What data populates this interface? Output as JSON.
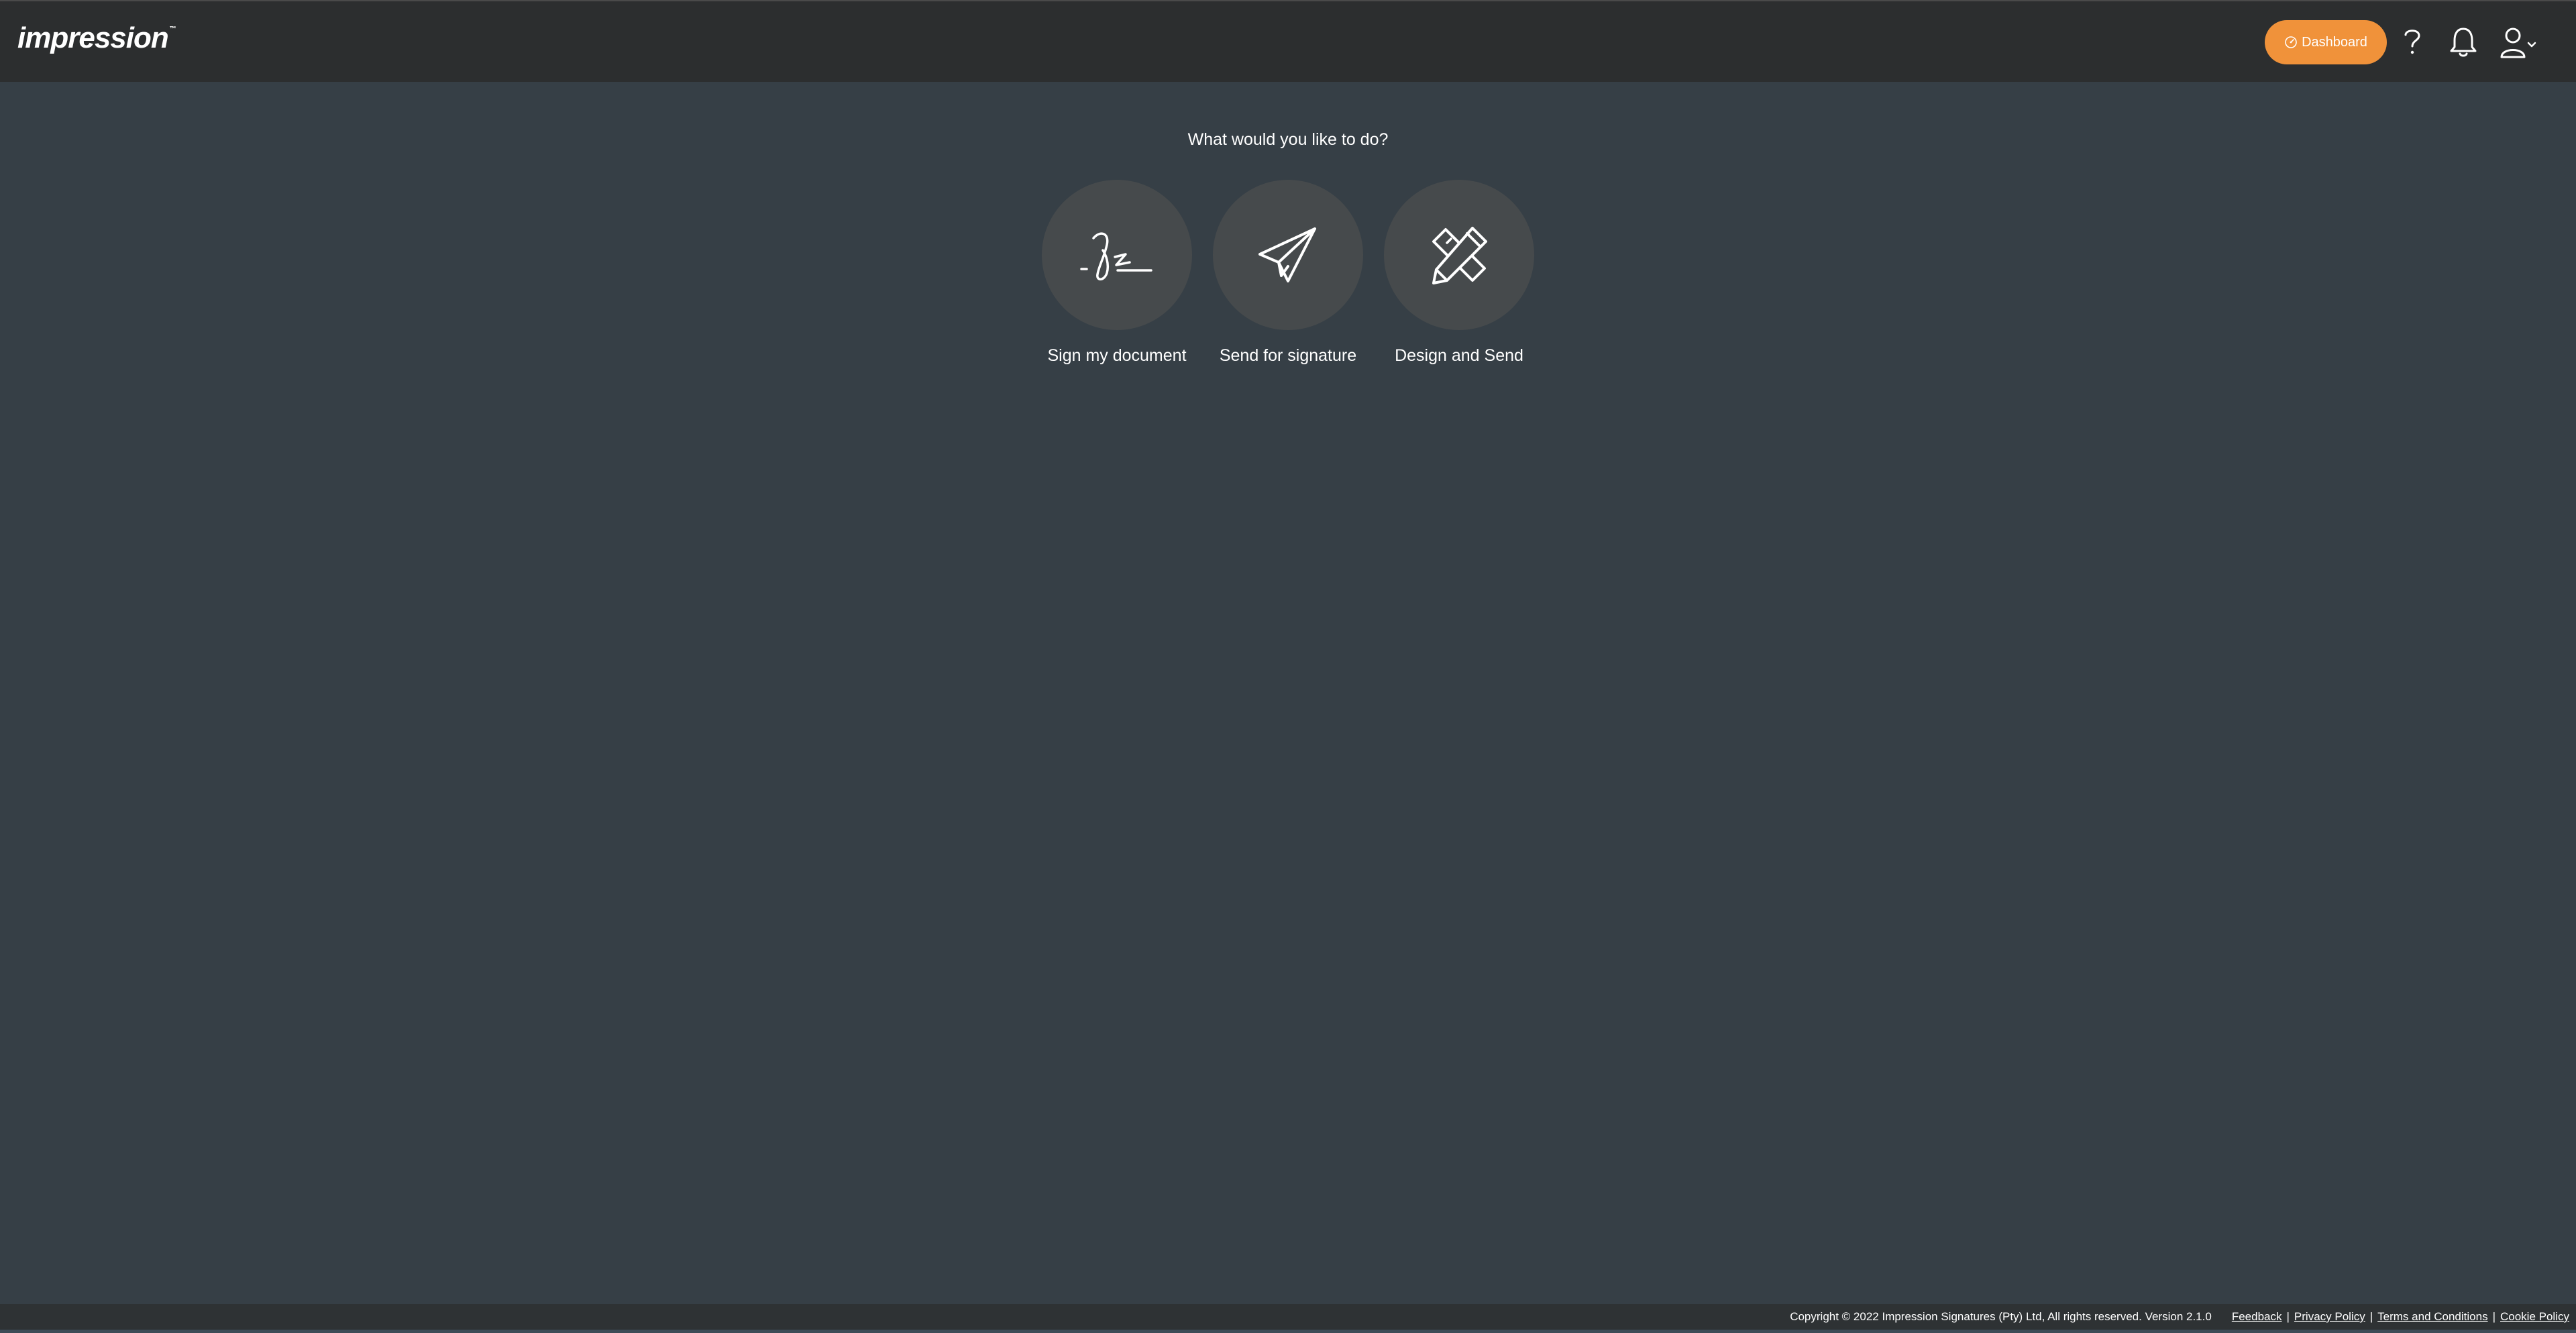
{
  "header": {
    "logo_text": "impression",
    "logo_mark": "™",
    "dashboard_label": "Dashboard",
    "icons": [
      "dashboard-icon",
      "help-icon",
      "bell-icon",
      "user-icon",
      "chevron-down-icon"
    ],
    "accent_color": "#f0923a"
  },
  "main": {
    "question": "What would you like to do?",
    "actions": [
      {
        "label": "Sign my document",
        "icon": "signature-icon"
      },
      {
        "label": "Send for signature",
        "icon": "paper-plane-icon"
      },
      {
        "label": "Design and Send",
        "icon": "pencil-ruler-icon"
      }
    ]
  },
  "footer": {
    "copyright": "Copyright © 2022 Impression Signatures (Pty) Ltd, All rights reserved. Version 2.1.0",
    "links": [
      "Feedback",
      "Privacy Policy",
      "Terms and Conditions",
      "Cookie Policy"
    ],
    "separator": "|"
  }
}
